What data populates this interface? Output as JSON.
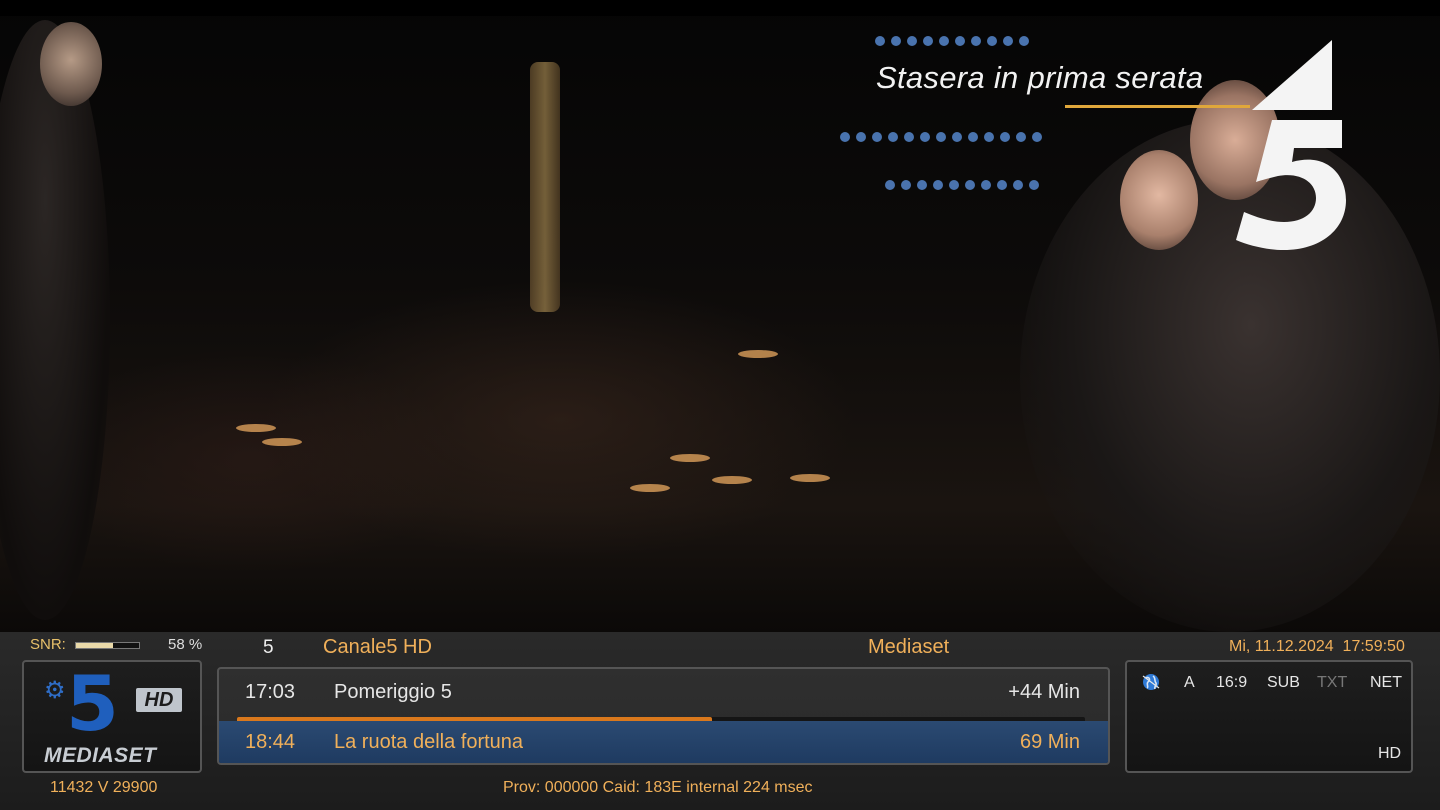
{
  "video": {
    "promo_text": "Stasera in prima serata",
    "accent_color": "#e0a73b"
  },
  "signal": {
    "snr_label": "SNR:",
    "snr_level": 0.58,
    "snr_value": "58 %"
  },
  "channel": {
    "number": "5",
    "name": "Canale5 HD",
    "provider": "Mediaset",
    "datetime": "Mi, 11.12.2024  17:59:50",
    "logo_hd": "HD",
    "logo_brand": "MEDIASET",
    "logo_digit": "5",
    "frequency": "11432 V 29900"
  },
  "epg": {
    "now": {
      "time": "17:03",
      "title": "Pomeriggio 5",
      "remaining": "+44 Min"
    },
    "progress": 0.56,
    "next": {
      "time": "18:44",
      "title": "La ruota della fortuna",
      "duration": "69 Min"
    }
  },
  "flags": {
    "icon": "globe-icon",
    "audio": "A",
    "aspect": "16:9",
    "subtitles": "SUB",
    "teletext": "TXT",
    "network": "NET",
    "resolution": "HD"
  },
  "ecm_info": "Prov: 000000 Caid: 183E internal 224 msec",
  "colors": {
    "label_gold": "#f0b05a",
    "progress": "#d9781c",
    "next_row": "#1e3a60",
    "brand_blue": "#1f5fbd"
  }
}
